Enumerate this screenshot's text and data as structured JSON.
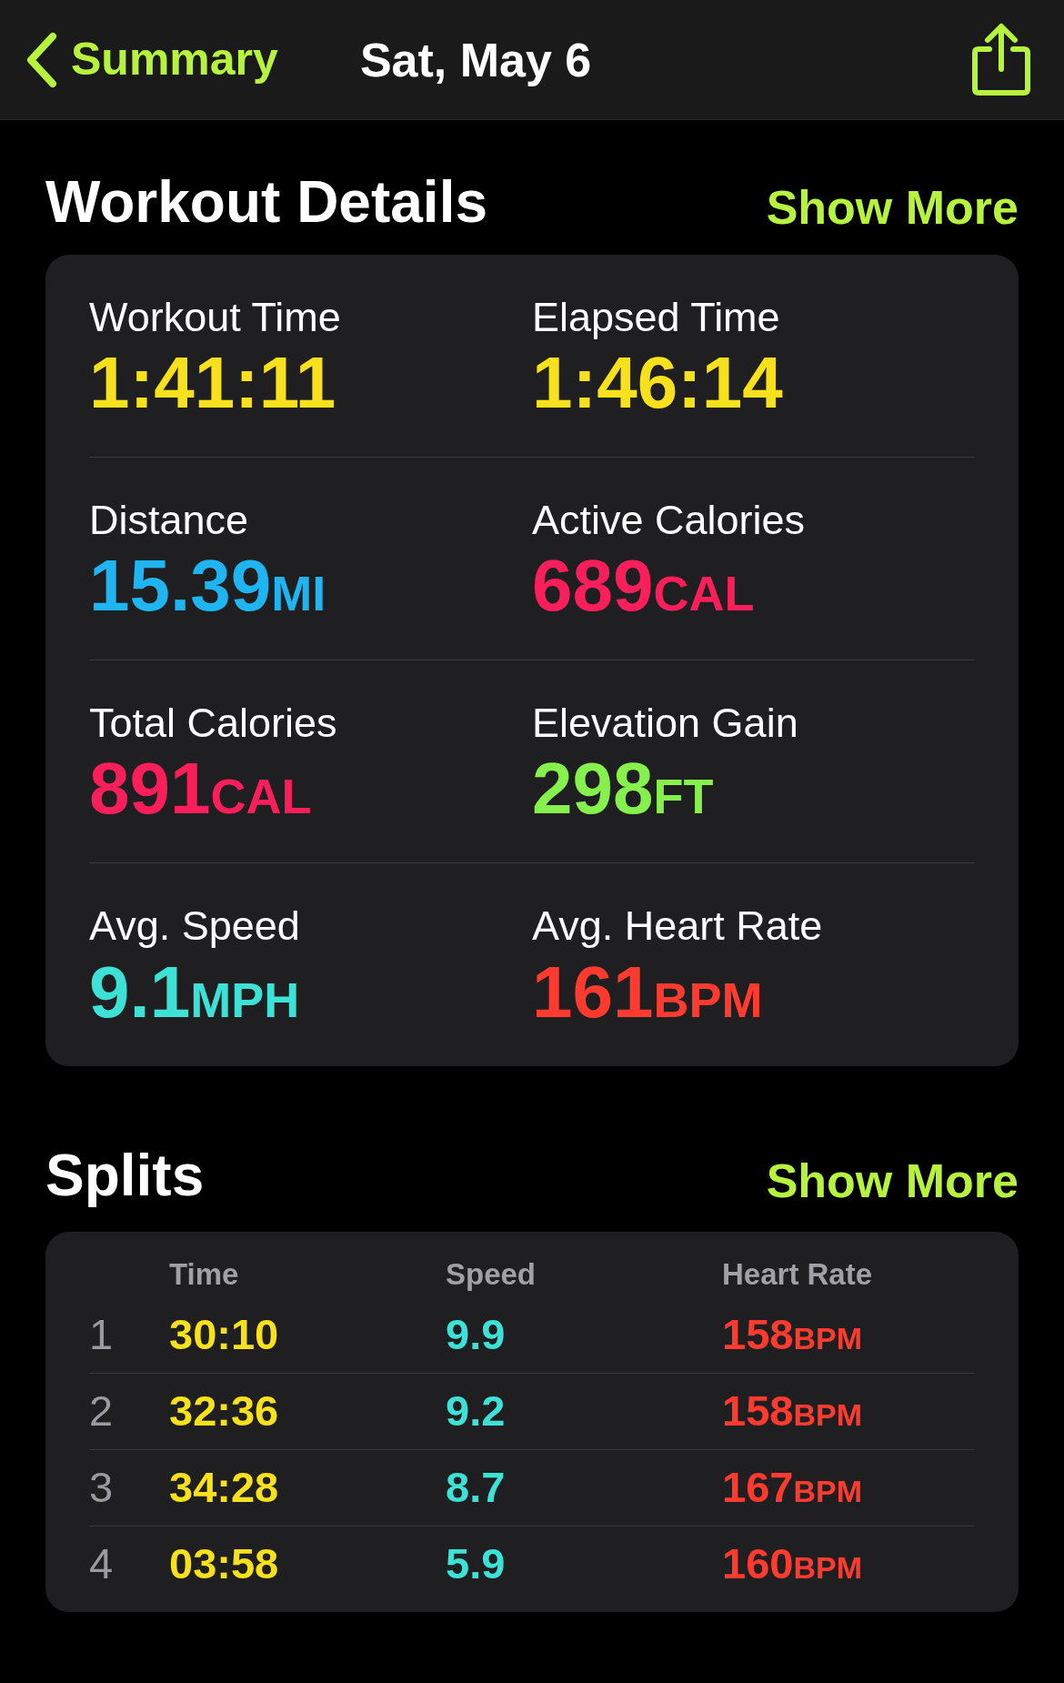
{
  "header": {
    "back_label": "Summary",
    "title": "Sat, May 6"
  },
  "workout_details": {
    "title": "Workout Details",
    "action": "Show More",
    "metrics": [
      {
        "label": "Workout Time",
        "value": "1:41:11",
        "color": "#f7e01c"
      },
      {
        "label": "Elapsed Time",
        "value": "1:46:14",
        "color": "#f7e01c"
      },
      {
        "label": "Distance",
        "value": "15.39",
        "unit": "MI",
        "color": "#1fb5f2"
      },
      {
        "label": "Active Calories",
        "value": "689",
        "unit": "CAL",
        "color": "#fa1f5a"
      },
      {
        "label": "Total Calories",
        "value": "891",
        "unit": "CAL",
        "color": "#fa1f5a"
      },
      {
        "label": "Elevation Gain",
        "value": "298",
        "unit": "FT",
        "color": "#86f04c"
      },
      {
        "label": "Avg. Speed",
        "value": "9.1",
        "unit": "MPH",
        "color": "#3de1d6"
      },
      {
        "label": "Avg. Heart Rate",
        "value": "161",
        "unit": "BPM",
        "color": "#ff3b2f"
      }
    ]
  },
  "splits": {
    "title": "Splits",
    "action": "Show More",
    "columns": [
      "Time",
      "Speed",
      "Heart Rate"
    ],
    "rows": [
      {
        "index": "1",
        "time": "30:10",
        "speed": "9.9",
        "heart_rate": "158",
        "unit": "BPM"
      },
      {
        "index": "2",
        "time": "32:36",
        "speed": "9.2",
        "heart_rate": "158",
        "unit": "BPM"
      },
      {
        "index": "3",
        "time": "34:28",
        "speed": "8.7",
        "heart_rate": "167",
        "unit": "BPM"
      },
      {
        "index": "4",
        "time": "03:58",
        "speed": "5.9",
        "heart_rate": "160",
        "unit": "BPM"
      }
    ]
  }
}
